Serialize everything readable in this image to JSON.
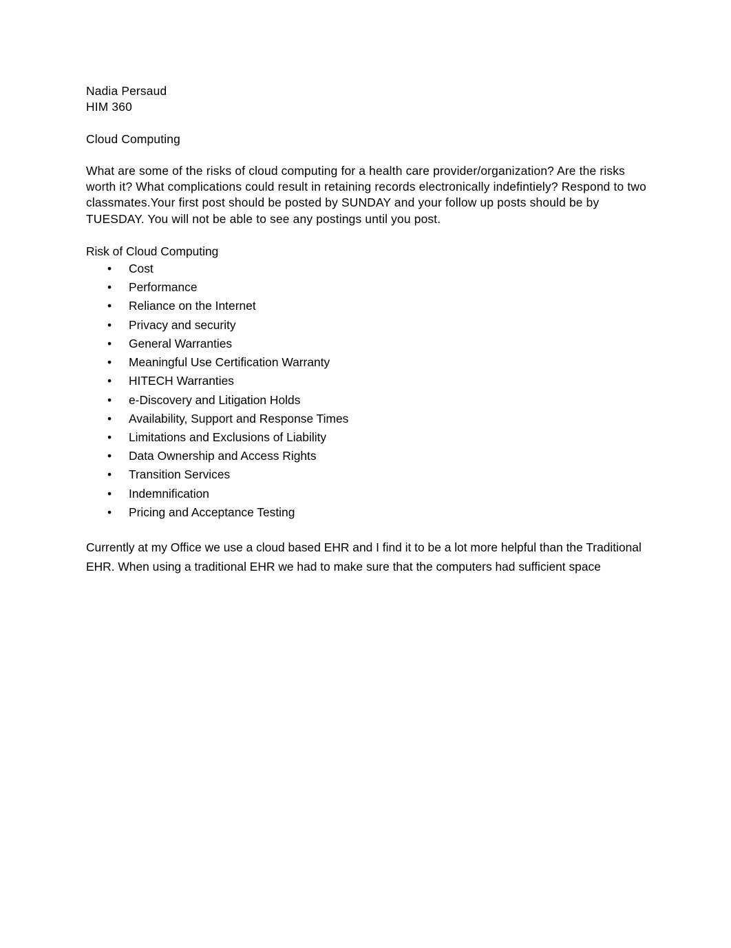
{
  "document": {
    "author": "Nadia Persaud",
    "course": "HIM 360",
    "title": "Cloud Computing",
    "prompt_paragraph": "What are some of the risks of cloud computing for a health care provider/organization? Are the risks worth it? What complications could result in retaining records electronically indefintiely? Respond to two classmates.Your first post should be posted by SUNDAY and your follow up posts should be by TUESDAY. You will not be able to see any postings until you post.",
    "list_heading": "Risk of Cloud Computing",
    "bullet_glyph": "•",
    "risks": [
      "Cost",
      "Performance",
      "Reliance on the Internet",
      "Privacy and security",
      "General Warranties",
      "Meaningful Use Certification Warranty",
      "HITECH Warranties",
      "e-Discovery and Litigation Holds",
      "Availability, Support and Response Times",
      "Limitations and Exclusions of Liability",
      "Data Ownership and Access Rights",
      "Transition Services",
      "Indemnification",
      "Pricing and Acceptance Testing"
    ],
    "closing_paragraph": "Currently at my Office we use a cloud based EHR and I find it to be a lot more helpful than the Traditional EHR. When using a traditional EHR we had to make sure that the computers had sufficient space",
    "colors": {
      "text": "#000000",
      "page_background": "#ffffff"
    }
  }
}
